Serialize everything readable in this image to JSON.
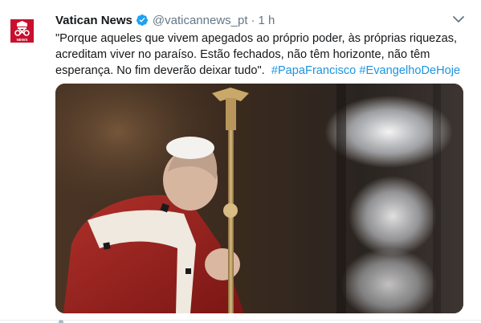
{
  "tweet": {
    "display_name": "Vatican News",
    "handle": "@vaticannews_pt",
    "separator": "·",
    "time": "1 h",
    "text_lines": [
      "\"Porque aqueles que vivem apegados ao próprio poder, às próprias riquezas,",
      "acreditam viver no paraíso. Estão fechados, não têm horizonte, não têm",
      "esperança. No fim deverão deixar tudo\"."
    ],
    "hashtags": [
      "#PapaFrancisco",
      "#EvangelhoDeHoje"
    ],
    "avatar_label": "NEWS"
  },
  "colors": {
    "brand_red": "#c8102e",
    "verified_blue": "#1da1f2",
    "link_blue": "#1b95e0",
    "secondary_text": "#657786"
  },
  "icons": [
    "verified-badge-icon",
    "chevron-down-icon"
  ]
}
